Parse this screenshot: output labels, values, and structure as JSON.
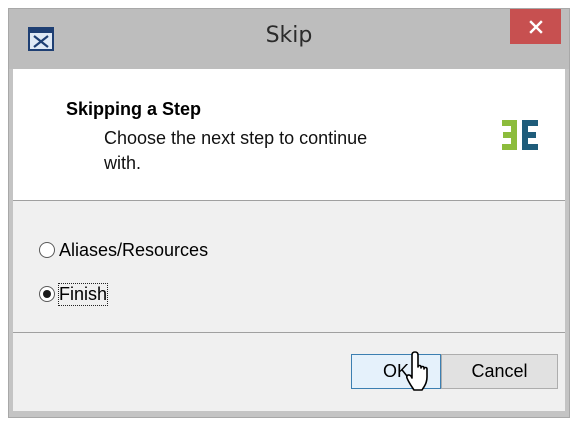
{
  "window": {
    "title": "Skip"
  },
  "header": {
    "title": "Skipping a Step",
    "description": "Choose the next step to continue with."
  },
  "options": [
    {
      "label": "Aliases/Resources",
      "selected": false
    },
    {
      "label": "Finish",
      "selected": true
    }
  ],
  "buttons": {
    "ok": "OK",
    "cancel": "Cancel"
  },
  "icons": {
    "app": "dialog-app-icon",
    "close": "close-icon",
    "logo": "product-logo-icon",
    "cursor": "mouse-pointer-icon"
  },
  "colors": {
    "close_button": "#c75050",
    "logo_green": "#8cbc3c",
    "logo_blue": "#1f5c7a",
    "default_button_border": "#3c7fb1"
  }
}
